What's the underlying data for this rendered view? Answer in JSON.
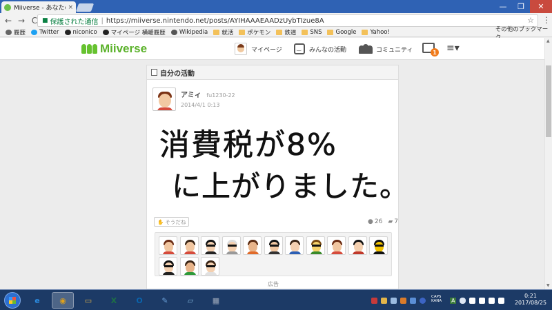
{
  "browser": {
    "tab_title": "Miiverse - あなたの投稿",
    "tab_close": "×",
    "window_controls": {
      "minimize": "—",
      "maximize": "❐",
      "close": "✕"
    },
    "nav": {
      "back": "←",
      "forward": "→",
      "reload": "C"
    },
    "omnibox": {
      "lock_icon": "lock-icon",
      "security_label": "保護された通信",
      "url": "https://miiverse.nintendo.net/posts/AYIHAAAEAADzUybTIzue8A",
      "star": "☆"
    },
    "menu": "⋮",
    "bookmarks": [
      {
        "label": "履歴",
        "icon": "history-icon",
        "color": "#666666"
      },
      {
        "label": "Twitter",
        "icon": "twitter-icon",
        "color": "#1da1f2"
      },
      {
        "label": "niconico",
        "icon": "niconico-icon",
        "color": "#222222"
      },
      {
        "label": "マイページ 横暖履歴",
        "icon": "niconico-icon",
        "color": "#222222"
      },
      {
        "label": "Wikipedia",
        "icon": "wikipedia-icon",
        "color": "#555555"
      },
      {
        "label": "就活",
        "icon": "folder-icon",
        "color": "#f3c15a"
      },
      {
        "label": "ポケモン",
        "icon": "folder-icon",
        "color": "#f3c15a"
      },
      {
        "label": "鉄道",
        "icon": "folder-icon",
        "color": "#f3c15a"
      },
      {
        "label": "SNS",
        "icon": "folder-icon",
        "color": "#f3c15a"
      },
      {
        "label": "Google",
        "icon": "folder-icon",
        "color": "#f3c15a"
      },
      {
        "label": "Yahoo!",
        "icon": "folder-icon",
        "color": "#f3c15a"
      }
    ],
    "other_bookmarks": "その他のブックマーク"
  },
  "miiverse": {
    "logo": "Miiverse",
    "nav": {
      "mypage": "マイページ",
      "activity": "みんなの活動",
      "community": "コミュニティ"
    },
    "notification_count": "1",
    "menu_icon": "≡▾",
    "brand_color": "#5bb22b"
  },
  "post": {
    "section_title": "自分の活動",
    "user_name": "アミィ",
    "user_id": "fu1230-22",
    "timestamp": "2014/4/1 0:13",
    "drawing_line1": "消費税が8%",
    "drawing_line2": "に上がりました。",
    "yeah_button": "そうだね",
    "yeah_count": "26",
    "comment_count": "7",
    "ad_label": "広告",
    "yeah_miis": [
      {
        "face": "#f1c6a0",
        "hair": "#6b2b12",
        "shirt": "#d64b3c"
      },
      {
        "face": "#f1c6a0",
        "hair": "#3a2515",
        "shirt": "#d64b3c"
      },
      {
        "face": "#f4d0b0",
        "hair": "#111111",
        "shirt": "#222222",
        "glasses": true
      },
      {
        "face": "#f4d0b0",
        "hair": "#dddddd",
        "shirt": "#999999",
        "glasses": true
      },
      {
        "face": "#e8b48a",
        "hair": "#5a2a10",
        "shirt": "#e06a2a"
      },
      {
        "face": "#f1c6a0",
        "hair": "#111111",
        "shirt": "#333333",
        "glasses": true
      },
      {
        "face": "#f4d0b0",
        "hair": "#3a2515",
        "shirt": "#2c5fb5"
      },
      {
        "face": "#f6d26a",
        "hair": "#7a4a10",
        "shirt": "#3a8a2a",
        "glasses": true
      },
      {
        "face": "#f1c6a0",
        "hair": "#6b2b12",
        "shirt": "#d64b3c"
      },
      {
        "face": "#f4d0b0",
        "hair": "#111111",
        "shirt": "#c0392b"
      },
      {
        "face": "#f2c200",
        "hair": "#111111",
        "shirt": "#111111",
        "glasses": true
      },
      {
        "face": "#f4d0b0",
        "hair": "#111111",
        "shirt": "#222222",
        "glasses": true
      },
      {
        "face": "#e8b48a",
        "hair": "#3a2515",
        "shirt": "#2f9a3a"
      },
      {
        "face": "#f4d0b0",
        "hair": "#3a2515",
        "shirt": "#e0e0e0",
        "glasses": true
      }
    ]
  },
  "taskbar": {
    "apps": [
      {
        "label": "e",
        "icon": "internet-explorer-icon",
        "color": "#2b8be0"
      },
      {
        "label": "◉",
        "icon": "chrome-icon",
        "color": "#e0a21a",
        "active": true
      },
      {
        "label": "▭",
        "icon": "file-explorer-icon",
        "color": "#e2b54a"
      },
      {
        "label": "X",
        "icon": "excel-icon",
        "color": "#1e7145"
      },
      {
        "label": "O",
        "icon": "outlook-icon",
        "color": "#0a64ad"
      },
      {
        "label": "✎",
        "icon": "paint-icon",
        "color": "#6aa0d8"
      },
      {
        "label": "▱",
        "icon": "notes-icon",
        "color": "#7fb3d8"
      },
      {
        "label": "▦",
        "icon": "calculator-icon",
        "color": "#9aa6b8"
      }
    ],
    "ime_top": "CAPS",
    "ime_bottom": "KANA",
    "ime_mode": "A",
    "clock_time": "0:21",
    "clock_date": "2017/08/25"
  }
}
